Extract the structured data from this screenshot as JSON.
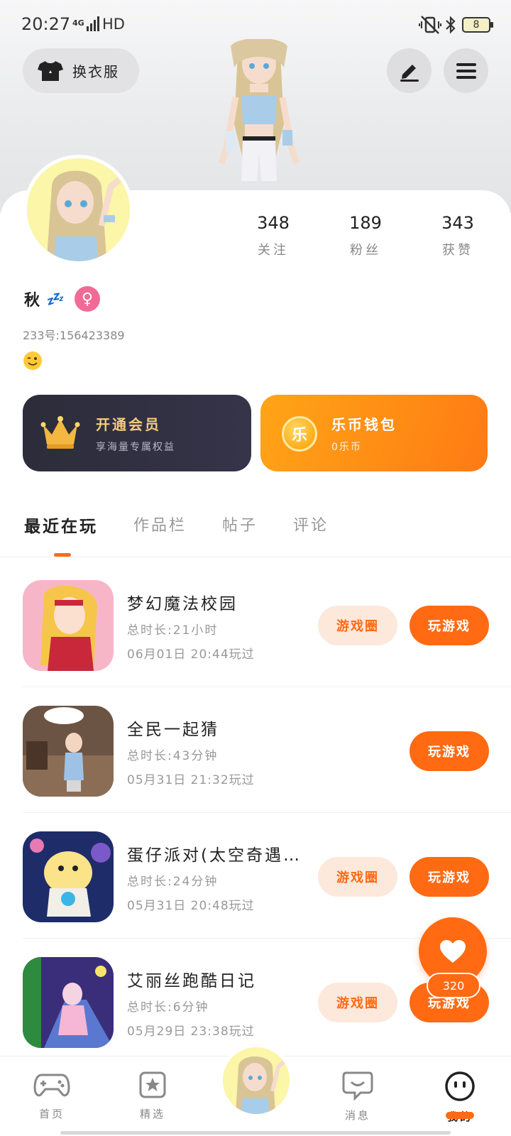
{
  "status_bar": {
    "time": "20:27",
    "network": "4G",
    "hd": "HD",
    "battery": "8"
  },
  "header": {
    "outfit_label": "换衣服"
  },
  "profile": {
    "stats": [
      {
        "value": "348",
        "label": "关注"
      },
      {
        "value": "189",
        "label": "粉丝"
      },
      {
        "value": "343",
        "label": "获赞"
      }
    ],
    "name": "秋",
    "name_emoji": "💤",
    "gender_symbol": "♀",
    "uid": "233号:156423389",
    "bio_emoji": "😉"
  },
  "promos": {
    "vip": {
      "title": "开通会员",
      "subtitle": "享海量专属权益"
    },
    "wallet": {
      "title": "乐币钱包",
      "subtitle": "0乐币",
      "coin_glyph": "乐"
    }
  },
  "tabs": [
    "最近在玩",
    "作品栏",
    "帖子",
    "评论"
  ],
  "games": [
    {
      "title": "梦幻魔法校园",
      "duration": "总时长:21小时",
      "last_played": "06月01日 20:44玩过",
      "has_circle": true
    },
    {
      "title": "全民一起猜",
      "duration": "总时长:43分钟",
      "last_played": "05月31日 21:32玩过",
      "has_circle": false
    },
    {
      "title": "蛋仔派对(太空奇遇…",
      "duration": "总时长:24分钟",
      "last_played": "05月31日 20:48玩过",
      "has_circle": true
    },
    {
      "title": "艾丽丝跑酷日记",
      "duration": "总时长:6分钟",
      "last_played": "05月29日 23:38玩过",
      "has_circle": true
    }
  ],
  "buttons": {
    "circle": "游戏圈",
    "play": "玩游戏"
  },
  "floating": {
    "count": "320"
  },
  "nav": {
    "home": "首页",
    "featured": "精选",
    "messages": "消息",
    "mine": "我的"
  },
  "colors": {
    "accent": "#ff6a13",
    "vip_gold": "#f5cc7c",
    "vip_bg": "#2c2c3a"
  }
}
